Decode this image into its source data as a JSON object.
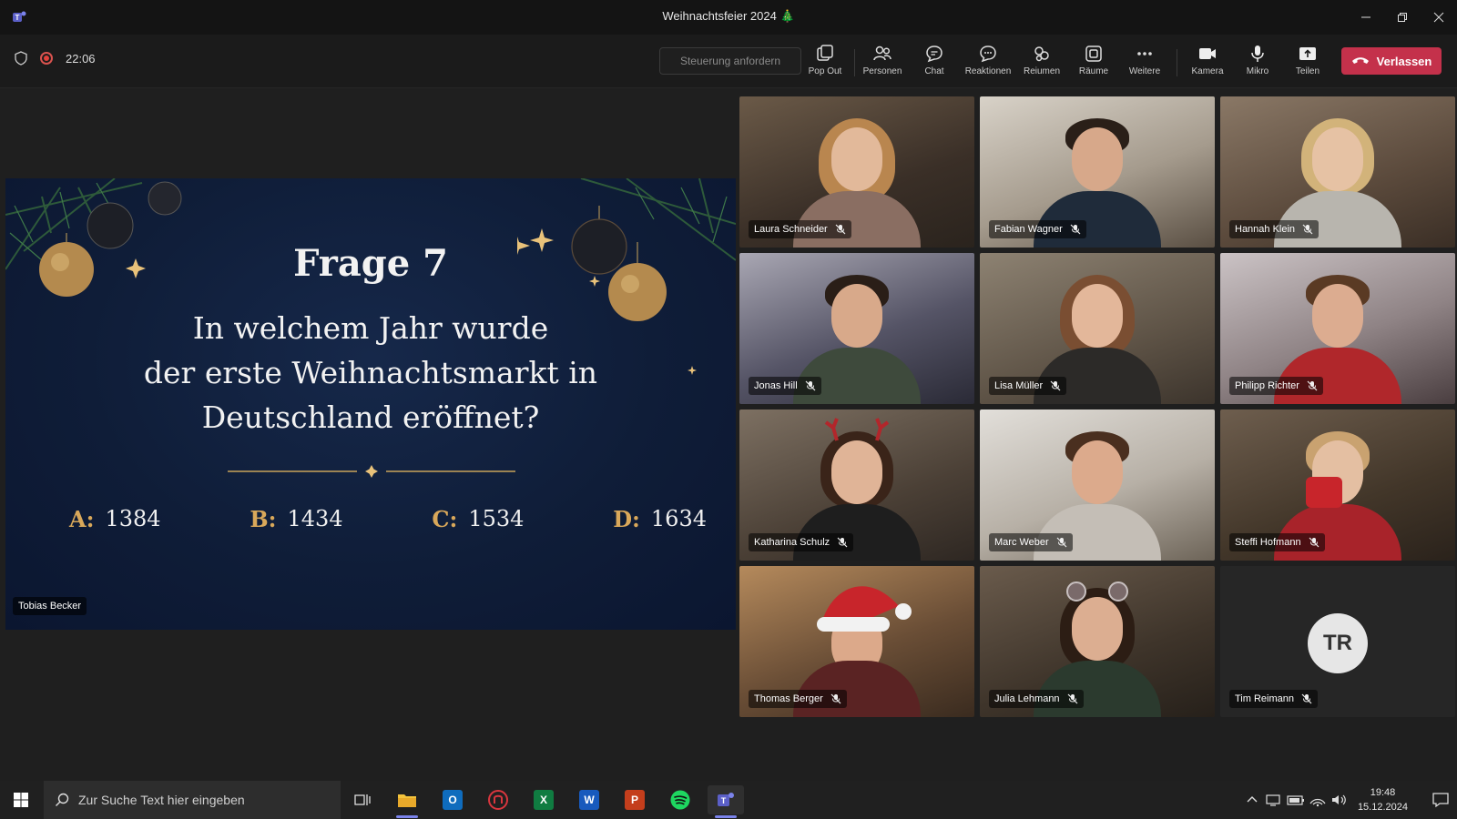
{
  "window": {
    "title": "Weihnachtsfeier 2024 🎄"
  },
  "toolbar": {
    "meeting_time": "22:06",
    "control_request": "Steuerung anfordern",
    "tools": [
      {
        "label": "Pop Out",
        "icon": "pop-out-icon"
      },
      {
        "label": "Personen",
        "icon": "people-icon"
      },
      {
        "label": "Chat",
        "icon": "chat-icon"
      },
      {
        "label": "Reaktionen",
        "icon": "reactions-icon"
      },
      {
        "label": "Reiumen",
        "icon": "apps-icon"
      },
      {
        "label": "Räume",
        "icon": "rooms-icon"
      },
      {
        "label": "Weitere",
        "icon": "more-icon"
      },
      {
        "label": "Kamera",
        "icon": "camera-icon"
      },
      {
        "label": "Mikro",
        "icon": "mic-icon"
      },
      {
        "label": "Teilen",
        "icon": "share-icon"
      }
    ],
    "leave_label": "Verlassen",
    "leave_color": "#c4314b"
  },
  "slide": {
    "title": "Frage 7",
    "question_lines": [
      "In welchem Jahr wurde",
      "der erste Weihnachtsmarkt in",
      "Deutschland eröffnet?"
    ],
    "answers": [
      {
        "letter": "A:",
        "value": "1384"
      },
      {
        "letter": "B:",
        "value": "1434"
      },
      {
        "letter": "C:",
        "value": "1534"
      },
      {
        "letter": "D:",
        "value": "1634"
      }
    ],
    "presenter": "Tobias Becker",
    "accent_color": "#d9a85a"
  },
  "participants": [
    {
      "name": "Laura Schneider"
    },
    {
      "name": "Fabian Wagner"
    },
    {
      "name": "Hannah Klein"
    },
    {
      "name": "Jonas Hill"
    },
    {
      "name": "Lisa Müller"
    },
    {
      "name": "Philipp Richter"
    },
    {
      "name": "Katharina Schulz"
    },
    {
      "name": "Marc Weber"
    },
    {
      "name": "Steffi Hofmann"
    },
    {
      "name": "Thomas Berger"
    },
    {
      "name": "Julia Lehmann"
    },
    {
      "name": "Tim Reimann",
      "initials": "TR"
    }
  ],
  "taskbar": {
    "search_placeholder": "Zur Suche Text hier eingeben",
    "time": "19:48",
    "date": "15.12.2024",
    "apps": [
      "task-view-icon",
      "file-explorer-icon",
      "outlook-icon",
      "app-red-icon",
      "excel-icon",
      "word-icon",
      "powerpoint-icon",
      "spotify-icon",
      "teams-icon"
    ]
  }
}
